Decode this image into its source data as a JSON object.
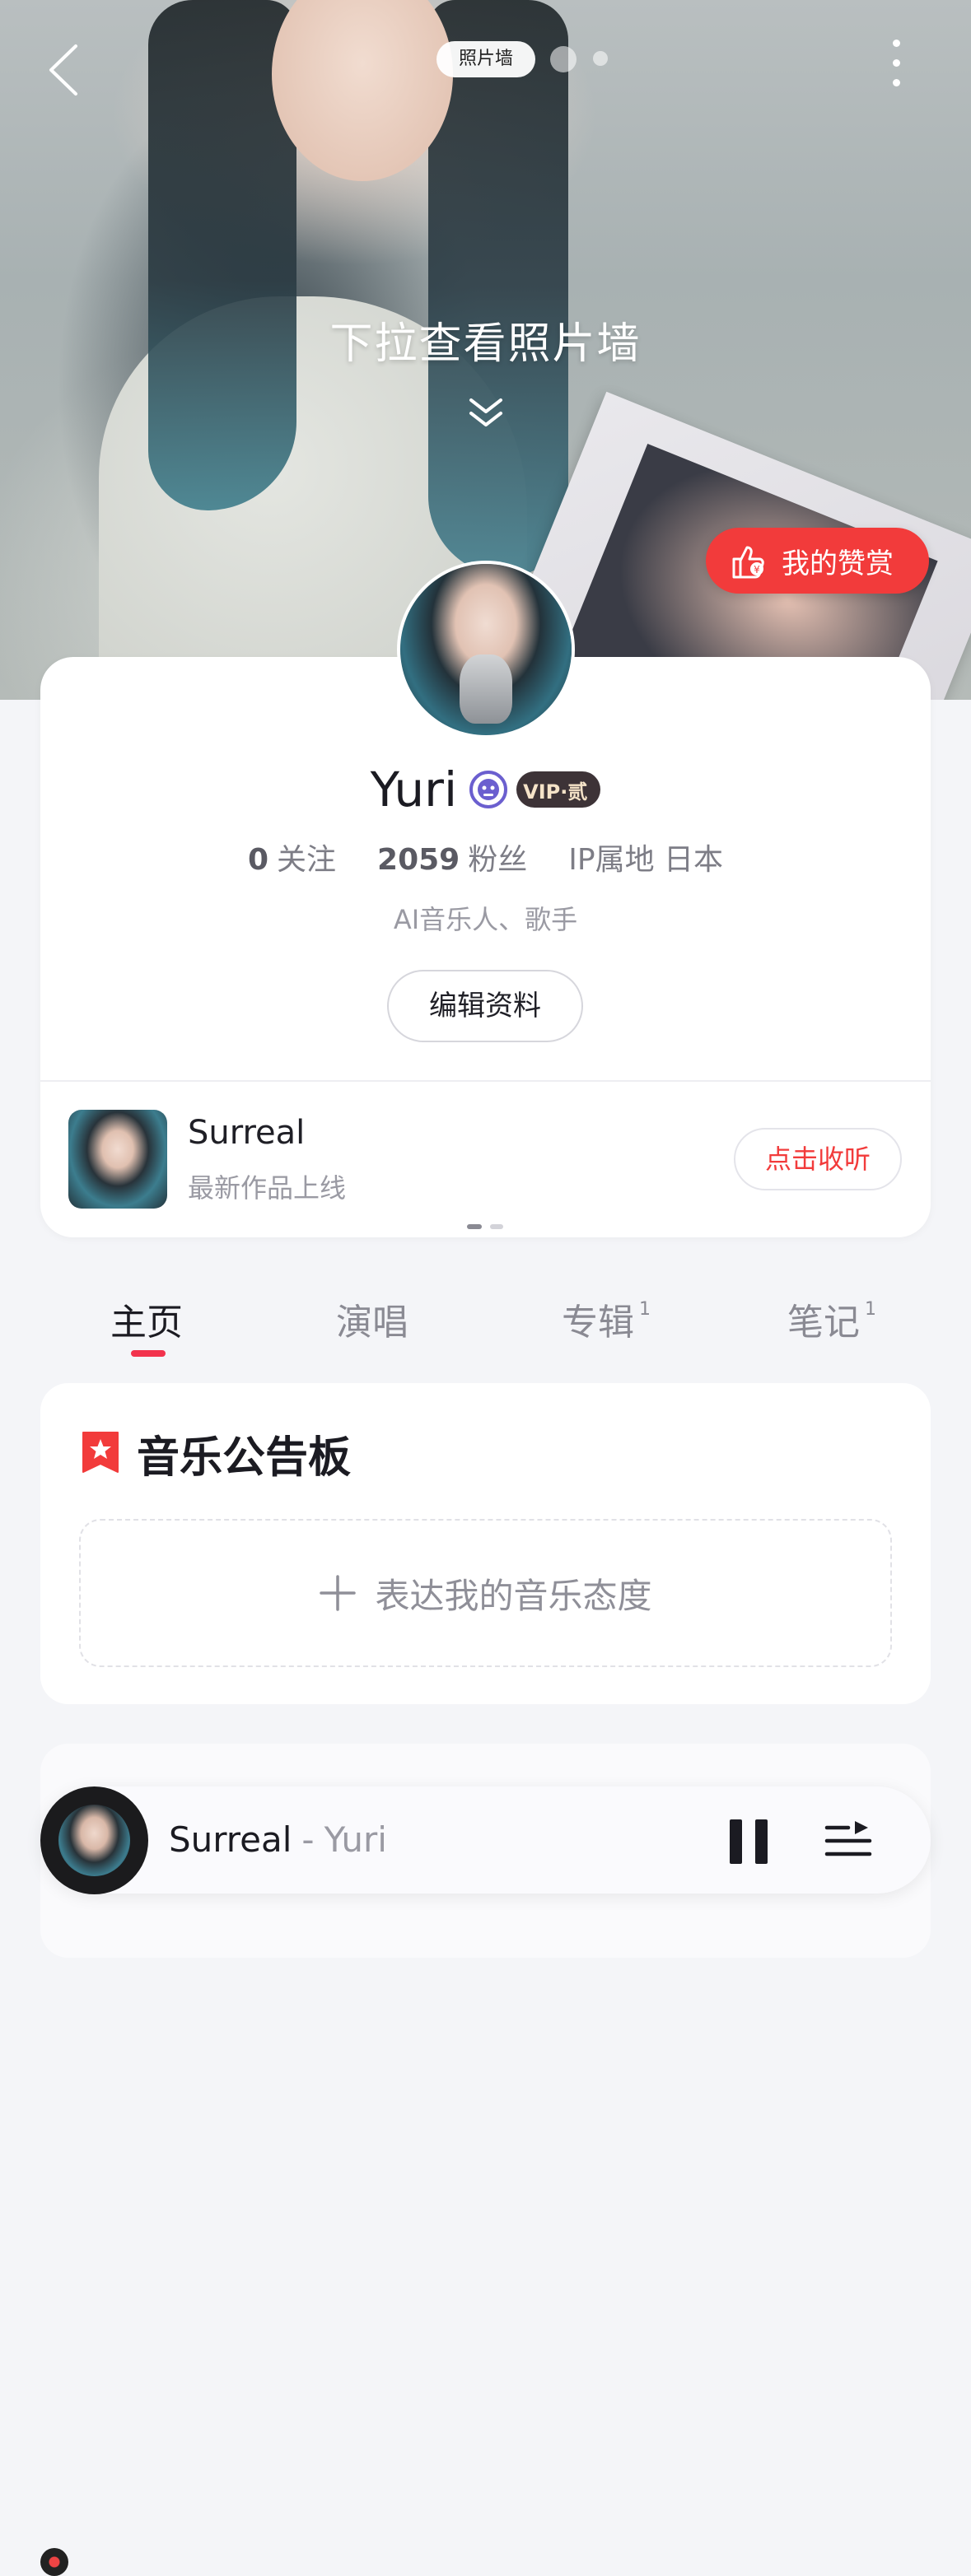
{
  "header": {
    "photo_wall_pill": "照片墙",
    "pull_hint": "下拉查看照片墙",
    "reward_button": "我的赞赏"
  },
  "profile": {
    "name": "Yuri",
    "vip_label": "VIP·贰",
    "following_count": "0",
    "following_label": "关注",
    "followers_count": "2059",
    "followers_label": "粉丝",
    "ip_location": "IP属地 日本",
    "bio": "AI音乐人、歌手",
    "edit_button": "编辑资料"
  },
  "latest_work": {
    "title": "Surreal",
    "subtitle": "最新作品上线",
    "listen_button": "点击收听"
  },
  "tabs": [
    {
      "label": "主页",
      "count": "",
      "active": true
    },
    {
      "label": "演唱",
      "count": ""
    },
    {
      "label": "专辑",
      "count": "1"
    },
    {
      "label": "笔记",
      "count": "1"
    }
  ],
  "board": {
    "title": "音乐公告板",
    "add_prompt": "表达我的音乐态度"
  },
  "player": {
    "title": "Surreal",
    "separator": "-",
    "artist": "Yuri",
    "state": "playing"
  },
  "colors": {
    "accent_red": "#f23b3b",
    "tab_underline": "#f2334d",
    "verified_purple": "#6b5fcf"
  },
  "icons": [
    "back-icon",
    "more-icon",
    "thumbs-up-coin-icon",
    "verified-icon",
    "vinyl-icon",
    "bookmark-star-icon",
    "plus-icon",
    "pause-icon",
    "playlist-icon",
    "double-chevron-down-icon"
  ]
}
